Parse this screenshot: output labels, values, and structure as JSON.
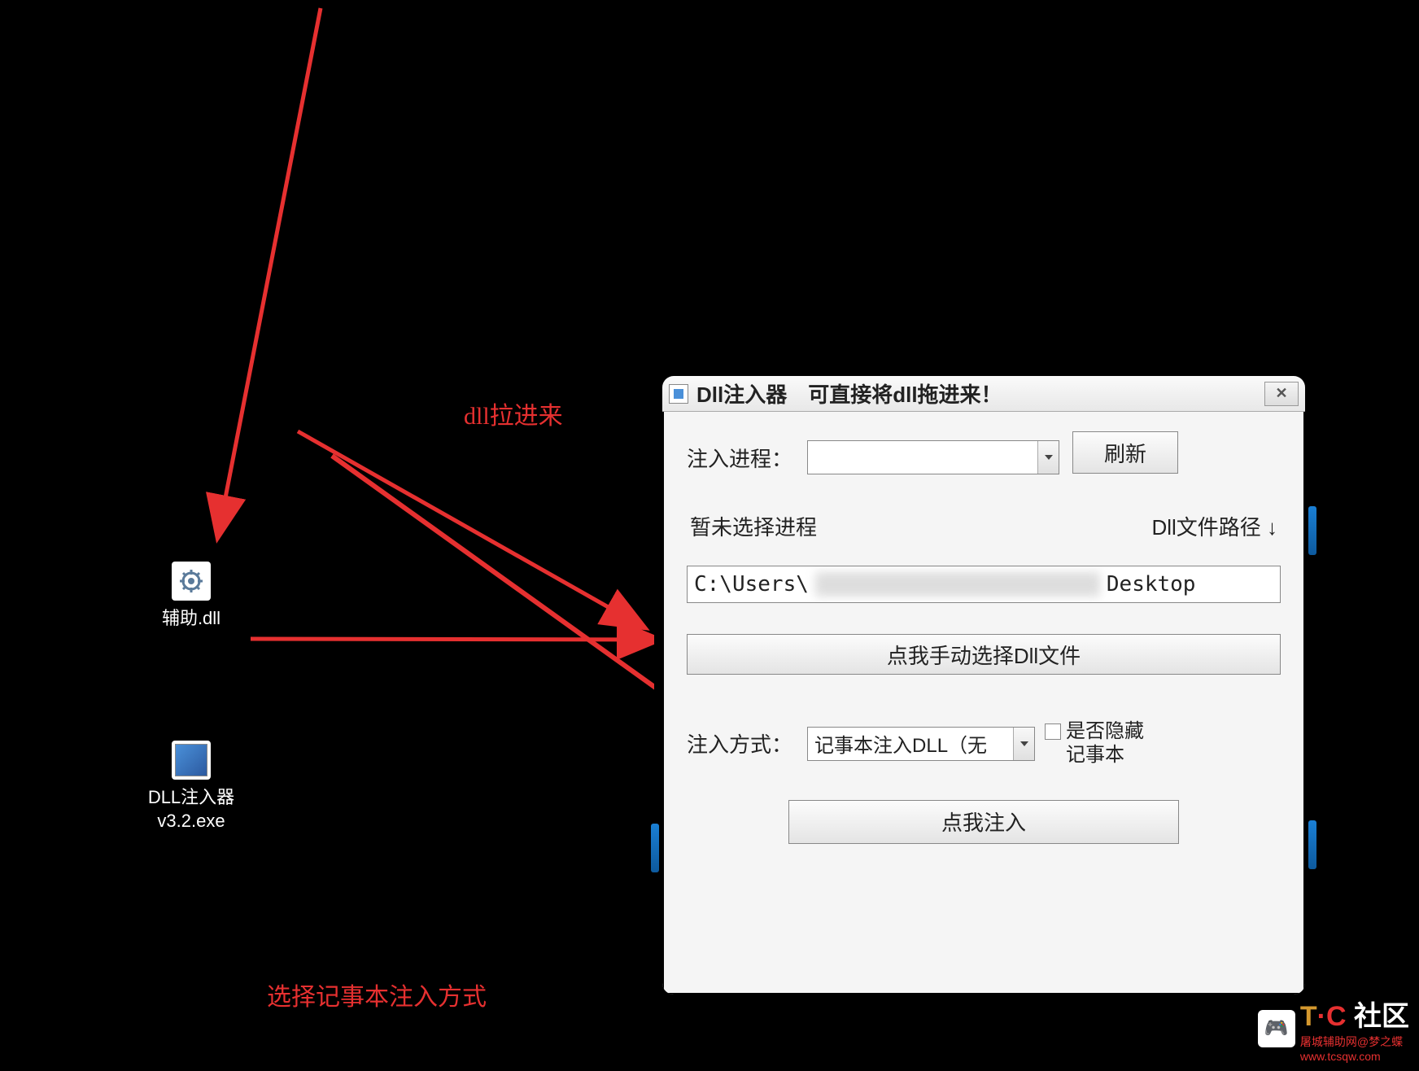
{
  "desktop": {
    "icons": {
      "dll": {
        "label": "辅助.dll"
      },
      "exe": {
        "label_line1": "DLL注入器",
        "label_line2": "v3.2.exe"
      }
    }
  },
  "annotations": {
    "drag_in": "dll拉进来",
    "select_method": "选择记事本注入方式"
  },
  "window": {
    "title": "Dll注入器　可直接将dll拖进来！",
    "process_label": "注入进程：",
    "refresh_button": "刷新",
    "no_process_text": "暂未选择进程",
    "dll_path_label": "Dll文件路径 ↓",
    "path_prefix": "C:\\Users\\",
    "path_suffix": "Desktop",
    "manual_select_button": "点我手动选择Dll文件",
    "method_label": "注入方式：",
    "method_value": "记事本注入DLL（无",
    "checkbox_label_line1": "是否隐藏",
    "checkbox_label_line2": "记事本",
    "inject_button": "点我注入"
  },
  "watermark": {
    "brand_t": "T",
    "brand_dot": "·",
    "brand_c": "C",
    "brand_text": " 社区",
    "subtitle": "屠城辅助网@梦之蝶",
    "url": "www.tcsqw.com"
  }
}
